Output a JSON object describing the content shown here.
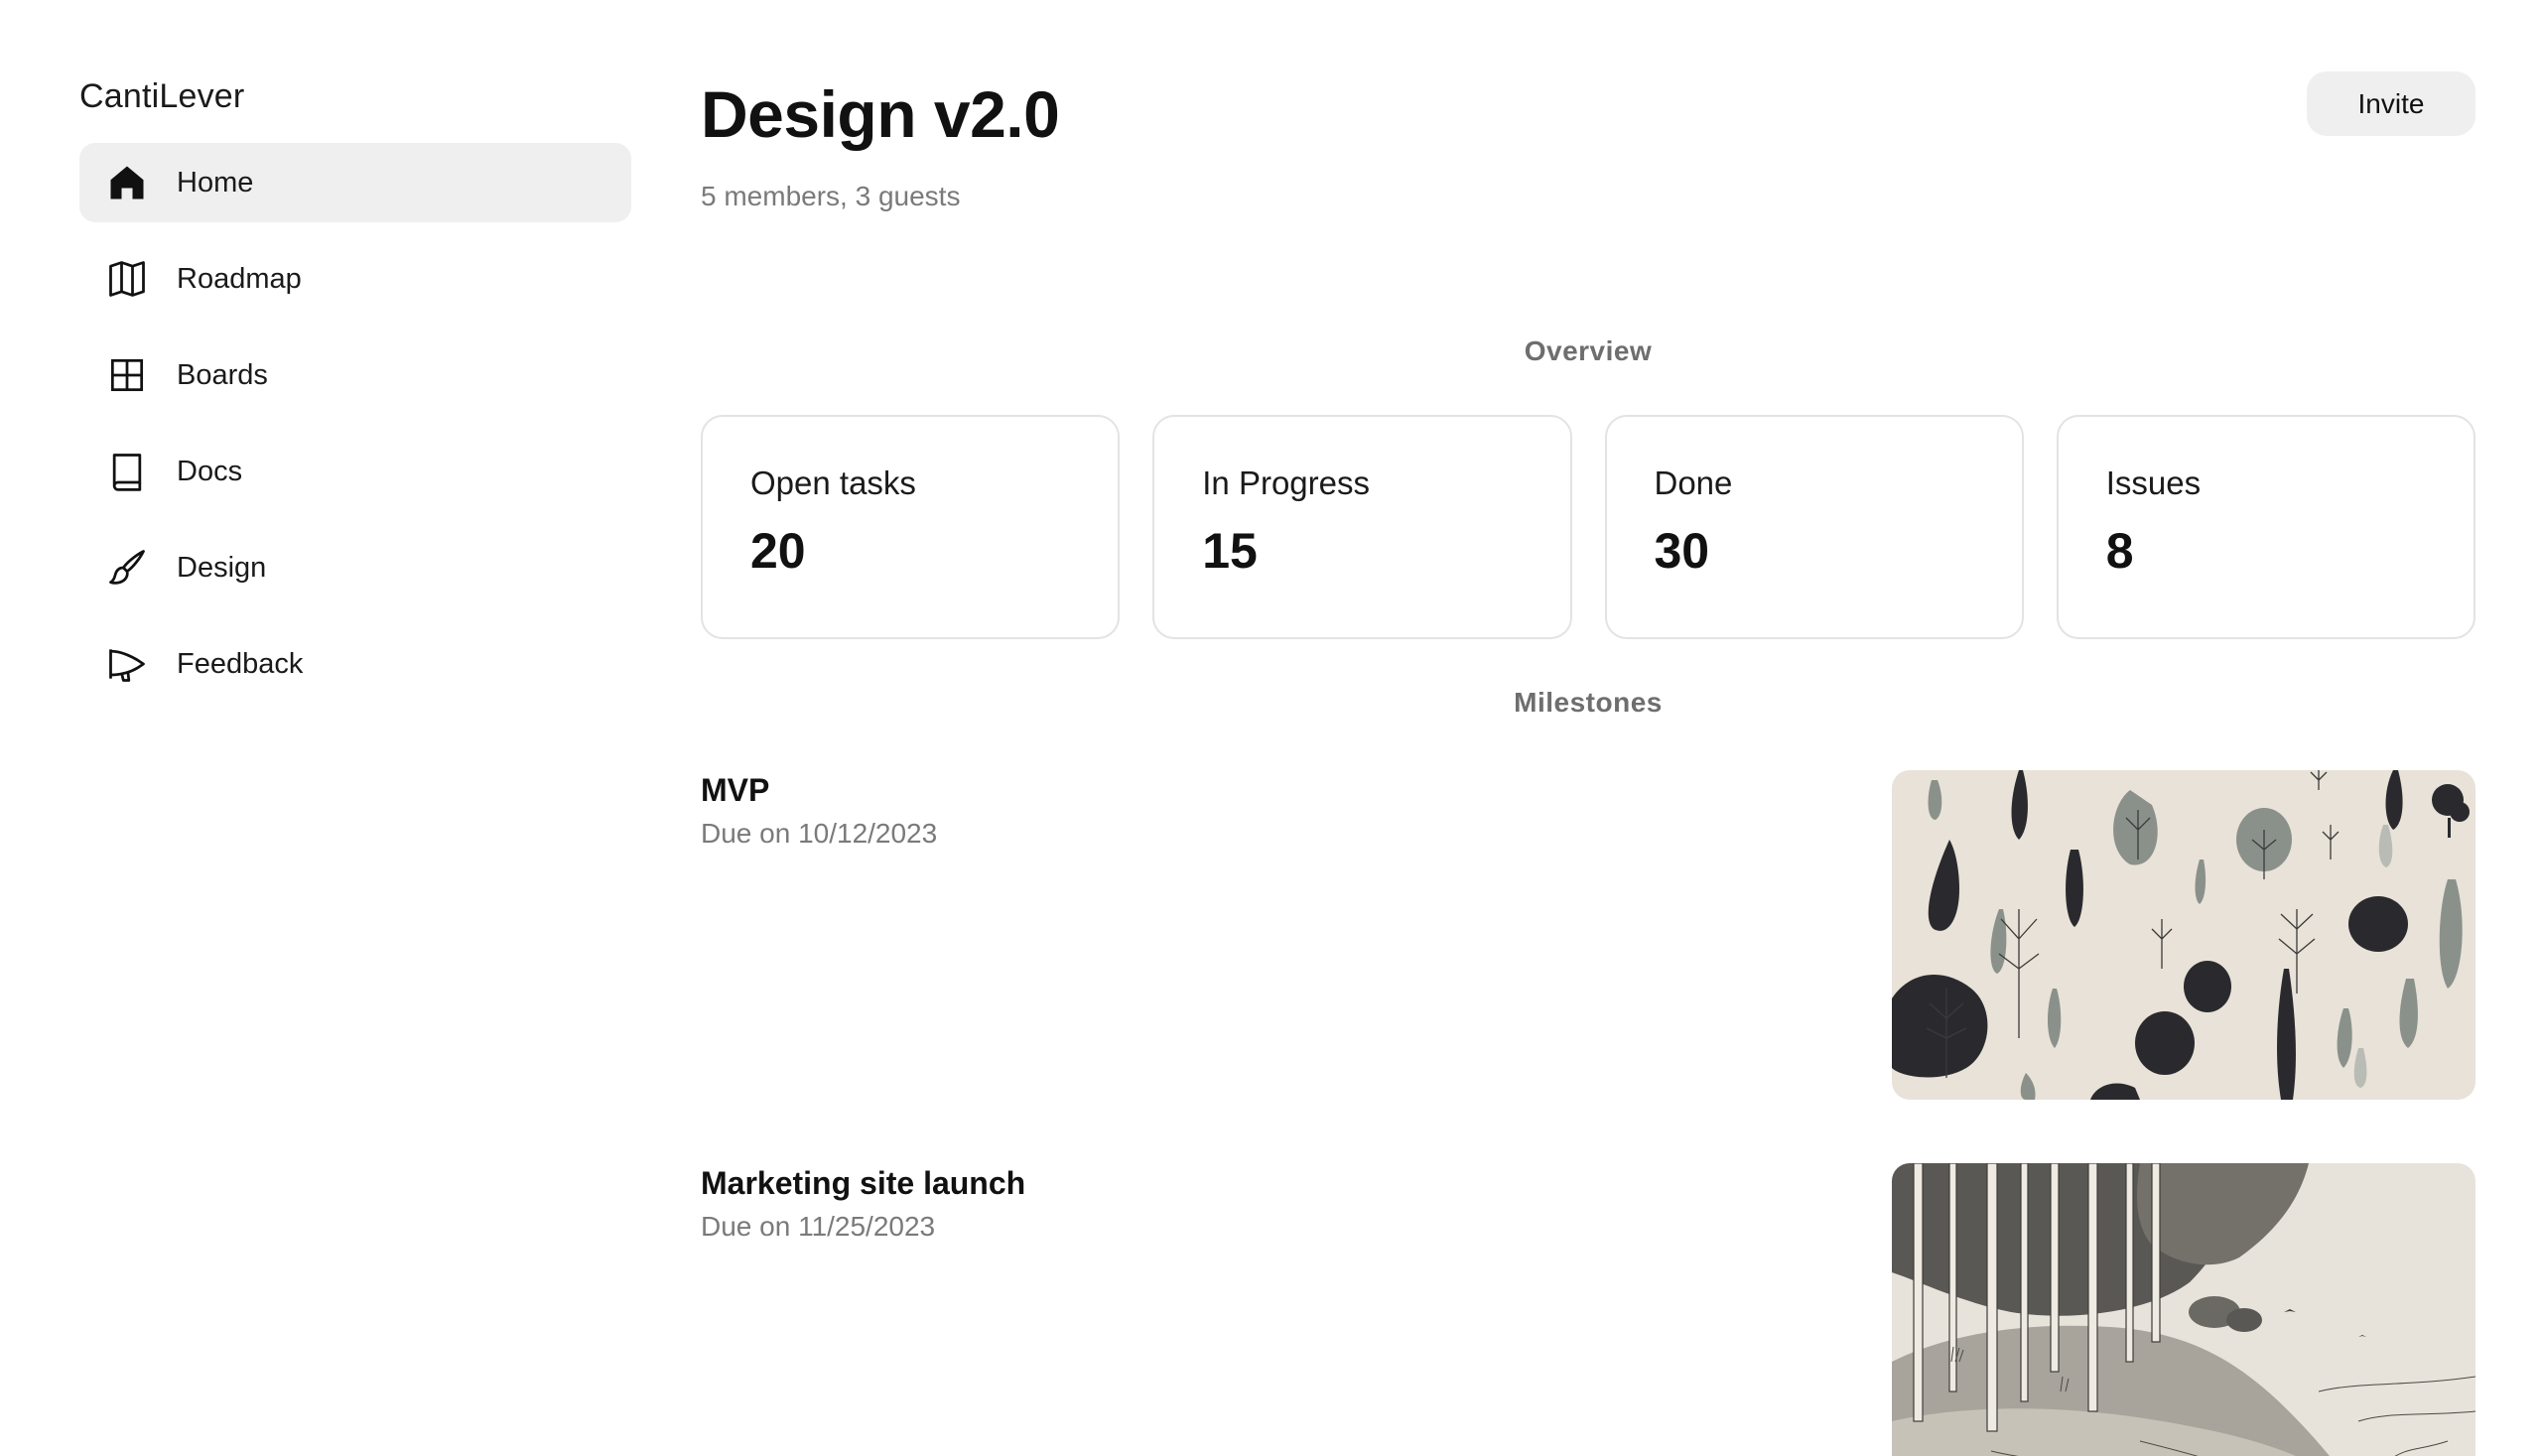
{
  "app": {
    "name": "CantiLever"
  },
  "sidebar": {
    "items": [
      {
        "label": "Home",
        "icon": "home-icon",
        "active": true
      },
      {
        "label": "Roadmap",
        "icon": "map-icon",
        "active": false
      },
      {
        "label": "Boards",
        "icon": "grid-icon",
        "active": false
      },
      {
        "label": "Docs",
        "icon": "book-icon",
        "active": false
      },
      {
        "label": "Design",
        "icon": "paintbrush-icon",
        "active": false
      },
      {
        "label": "Feedback",
        "icon": "megaphone-icon",
        "active": false
      }
    ]
  },
  "header": {
    "title": "Design v2.0",
    "subtitle": "5 members, 3 guests",
    "invite_label": "Invite"
  },
  "overview": {
    "label": "Overview",
    "stats": [
      {
        "label": "Open tasks",
        "value": "20"
      },
      {
        "label": "In Progress",
        "value": "15"
      },
      {
        "label": "Done",
        "value": "30"
      },
      {
        "label": "Issues",
        "value": "8"
      }
    ]
  },
  "milestones": {
    "label": "Milestones",
    "items": [
      {
        "title": "MVP",
        "due": "Due on 10/12/2023",
        "image": "trees-pattern-illustration"
      },
      {
        "title": "Marketing site launch",
        "due": "Due on 11/25/2023",
        "image": "birch-forest-shore-illustration"
      }
    ]
  },
  "colors": {
    "active_nav_bg": "#efefef",
    "card_border": "#e3e3e3",
    "muted_text": "#7a7a7a",
    "illustration_bg": "#e9e2d8"
  }
}
